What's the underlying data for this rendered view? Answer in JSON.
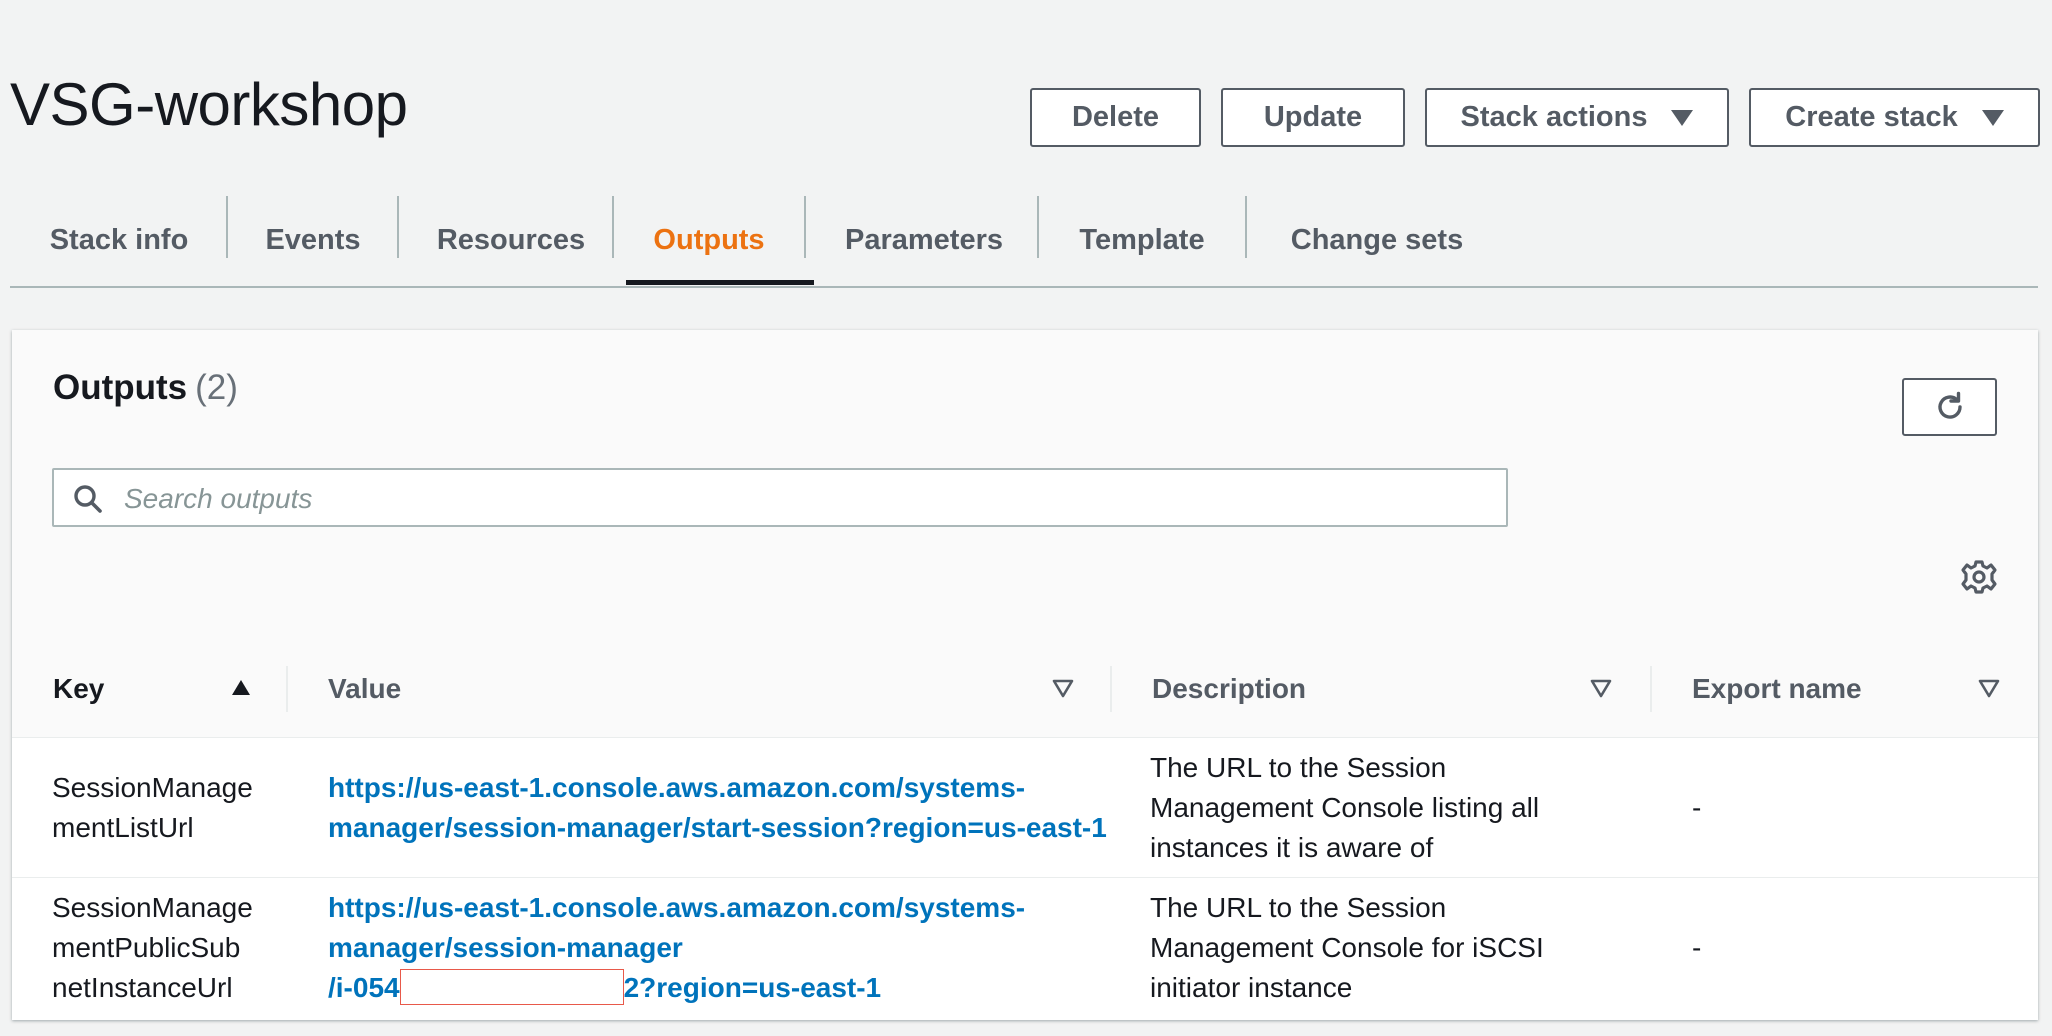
{
  "page": {
    "title": "VSG-workshop"
  },
  "actions": {
    "delete": "Delete",
    "update": "Update",
    "stack_actions": "Stack actions",
    "create_stack": "Create stack"
  },
  "tabs": [
    {
      "label": "Stack info",
      "active": false
    },
    {
      "label": "Events",
      "active": false
    },
    {
      "label": "Resources",
      "active": false
    },
    {
      "label": "Outputs",
      "active": true
    },
    {
      "label": "Parameters",
      "active": false
    },
    {
      "label": "Template",
      "active": false
    },
    {
      "label": "Change sets",
      "active": false
    }
  ],
  "outputs": {
    "title": "Outputs",
    "count": "(2)",
    "search_placeholder": "Search outputs",
    "columns": {
      "key": "Key",
      "value": "Value",
      "description": "Description",
      "export_name": "Export name"
    },
    "rows": [
      {
        "key_lines": [
          "SessionManage",
          "mentListUrl"
        ],
        "value_lines": [
          "https://us-east-1.console.aws.amazon.com/systems-",
          "manager/session-manager/start-session?region=us-east-1"
        ],
        "description_lines": [
          "The URL to the Session",
          "Management Console listing all",
          "instances it is aware of"
        ],
        "export_name": "-"
      },
      {
        "key_lines": [
          "SessionManage",
          "mentPublicSub",
          "netInstanceUrl"
        ],
        "value_lines": [
          "https://us-east-1.console.aws.amazon.com/systems-",
          "manager/session-manager"
        ],
        "value_prefix": "/i-054",
        "value_suffix": "2?region=us-east-1",
        "description_lines": [
          "The URL to the Session",
          "Management Console for iSCSI",
          "initiator instance"
        ],
        "export_name": "-"
      }
    ]
  },
  "colors": {
    "accent_active_tab": "#ec7211",
    "link": "#0073bb",
    "redaction_box": "#e8594a"
  },
  "icons": {
    "refresh": "refresh-icon",
    "search": "search-icon",
    "settings": "gear-icon",
    "sort_asc": "sort-ascending-icon",
    "sort_none": "sort-descending-outline-icon",
    "dropdown": "caret-down-icon"
  }
}
